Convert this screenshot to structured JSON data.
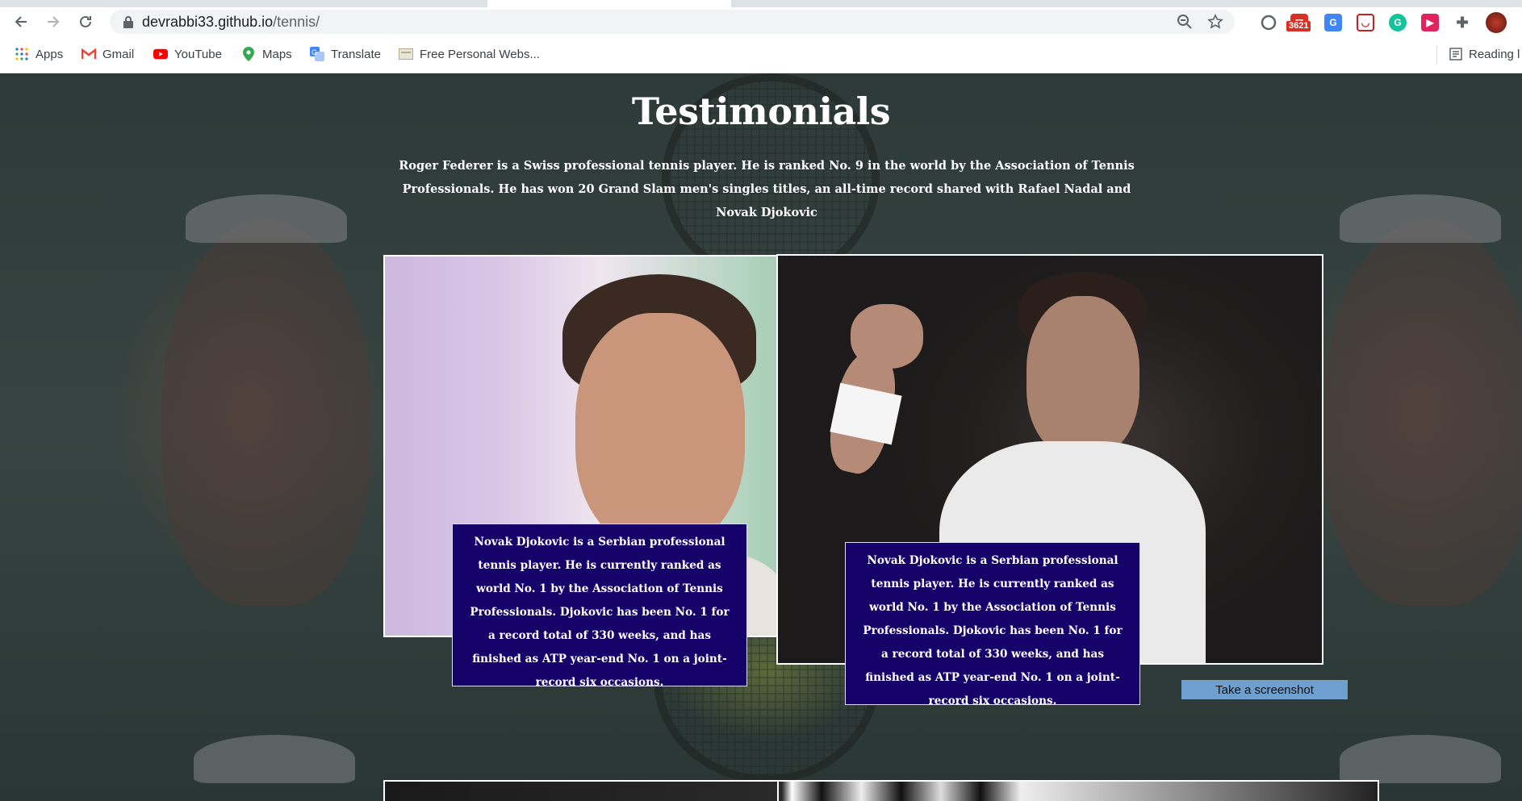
{
  "browser": {
    "url_host": "devrabbi33.github.io",
    "url_path": "/tennis/",
    "mail_badge": "3621",
    "bookmarks": [
      {
        "label": "Apps",
        "icon": "apps-grid-icon"
      },
      {
        "label": "Gmail",
        "icon": "gmail-icon"
      },
      {
        "label": "YouTube",
        "icon": "youtube-icon"
      },
      {
        "label": "Maps",
        "icon": "maps-icon"
      },
      {
        "label": "Translate",
        "icon": "translate-icon"
      },
      {
        "label": "Free Personal Webs...",
        "icon": "bookmark-page-icon"
      }
    ],
    "reading_list": "Reading l"
  },
  "page": {
    "title": "Testimonials",
    "intro": "Roger Federer is a Swiss professional tennis player. He is ranked No. 9 in the world by the Association of Tennis Professionals. He has won 20 Grand Slam men's singles titles, an all-time record shared with Rafael Nadal and Novak Djokovic",
    "cards": [
      {
        "caption": "Novak Djokovic is a Serbian professional tennis player. He is currently ranked as world No. 1 by the Association of Tennis Professionals. Djokovic has been No. 1 for a record total of 330 weeks, and has finished as ATP year-end No. 1 on a joint-record six occasions."
      },
      {
        "caption": "Novak Djokovic is a Serbian professional tennis player. He is currently ranked as world No. 1 by the Association of Tennis Professionals. Djokovic has been No. 1 for a record total of 330 weeks, and has finished as ATP year-end No. 1 on a joint-record six occasions."
      }
    ],
    "screenshot_button": "Take a screenshot"
  },
  "colors": {
    "caption_bg": "#15036a",
    "button_bg": "#6f9fcf"
  }
}
